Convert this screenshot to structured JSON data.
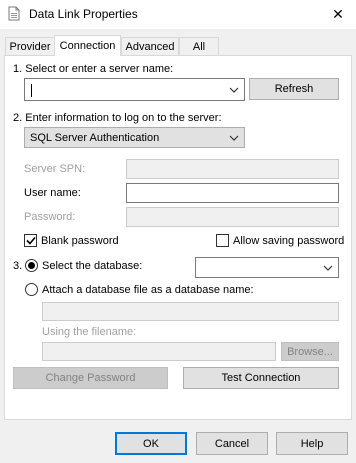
{
  "window": {
    "title": "Data Link Properties",
    "close_glyph": "✕",
    "icon": "data-link-icon"
  },
  "tabs": [
    {
      "label": "Provider",
      "active": false
    },
    {
      "label": "Connection",
      "active": true
    },
    {
      "label": "Advanced",
      "active": false
    },
    {
      "label": "All",
      "active": false
    }
  ],
  "step1": {
    "label": "1. Select or enter a server name:",
    "server_value": "",
    "refresh_label": "Refresh"
  },
  "step2": {
    "label": "2. Enter information to log on to the server:",
    "auth_value": "SQL Server Authentication",
    "spn_label": "Server SPN:",
    "username_label": "User name:",
    "username_value": "",
    "password_label": "Password:",
    "blank_password_label": "Blank password",
    "blank_password_checked": true,
    "allow_saving_label": "Allow saving password",
    "allow_saving_checked": false
  },
  "step3": {
    "number": "3.",
    "select_db_label": "Select the database:",
    "select_db_selected": true,
    "database_value": "",
    "attach_label": "Attach a database file as a database name:",
    "attach_selected": false,
    "filename_label": "Using the filename:",
    "browse_label": "Browse..."
  },
  "actions": {
    "change_password_label": "Change Password",
    "test_connection_label": "Test Connection"
  },
  "footer": {
    "ok_label": "OK",
    "cancel_label": "Cancel",
    "help_label": "Help"
  }
}
